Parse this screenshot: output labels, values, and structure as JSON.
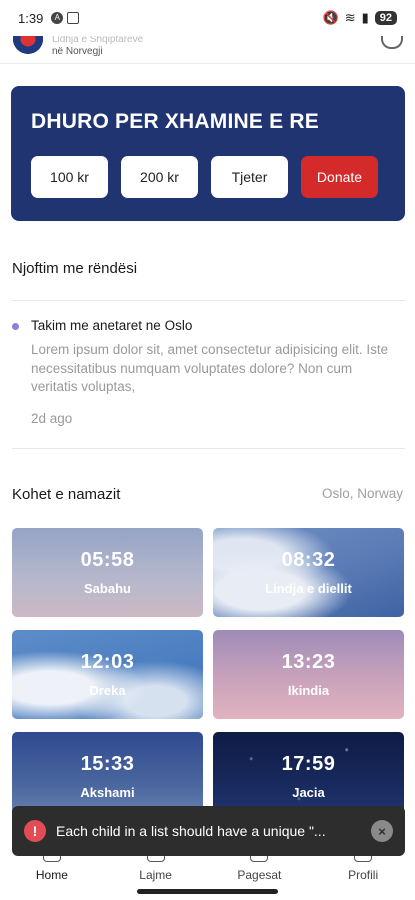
{
  "status_bar": {
    "time": "1:39",
    "battery": "92"
  },
  "header": {
    "org_name_line1": "Lidhja e Shqiptarëve",
    "org_name_line2": "në Norvegji"
  },
  "donate": {
    "title": "DHURO PER XHAMINE E RE",
    "amounts": [
      "100 kr",
      "200 kr",
      "Tjeter"
    ],
    "button_label": "Donate",
    "bg_color": "#1f3470",
    "button_color": "#d42a2a"
  },
  "notices": {
    "section_title": "Njoftim me rëndësi",
    "items": [
      {
        "title": "Takim me anetaret ne Oslo",
        "body": "Lorem ipsum dolor sit, amet consectetur adipisicing elit. Iste necessitatibus numquam voluptates dolore? Non cum veritatis voluptas,",
        "time": "2d ago"
      }
    ]
  },
  "prayer": {
    "section_title": "Kohet e namazit",
    "location": "Oslo, Norway",
    "times": [
      {
        "time": "05:58",
        "name": "Sabahu"
      },
      {
        "time": "08:32",
        "name": "Lindja e diellit"
      },
      {
        "time": "12:03",
        "name": "Dreka"
      },
      {
        "time": "13:23",
        "name": "Ikindia"
      },
      {
        "time": "15:33",
        "name": "Akshami"
      },
      {
        "time": "17:59",
        "name": "Jacia"
      }
    ]
  },
  "toast": {
    "icon": "!",
    "message": "Each child in a list should have a unique \"...",
    "close_icon": "×"
  },
  "nav": {
    "items": [
      {
        "label": "Home",
        "icon": "home-icon"
      },
      {
        "label": "Lajme",
        "icon": "news-icon"
      },
      {
        "label": "Pagesat",
        "icon": "payments-icon"
      },
      {
        "label": "Profili",
        "icon": "profile-icon"
      }
    ]
  }
}
